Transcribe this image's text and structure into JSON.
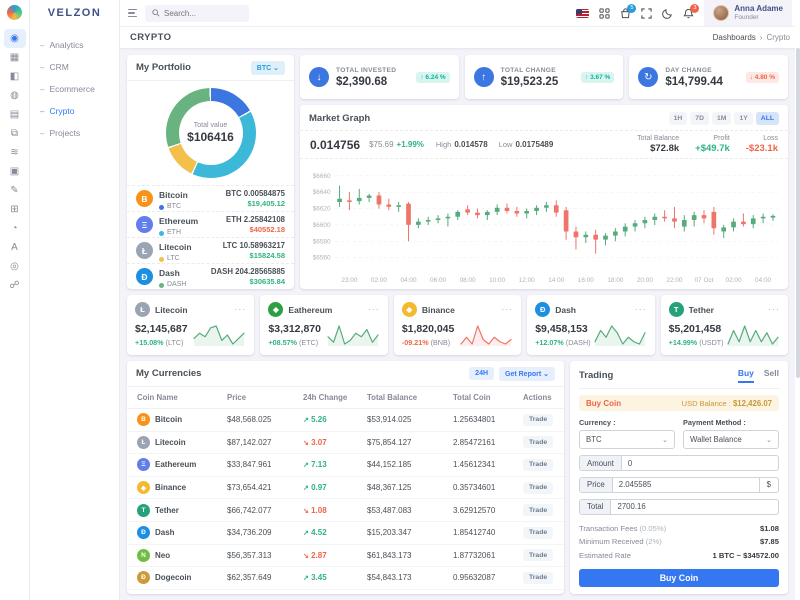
{
  "colors": {
    "accent": "#3577f1",
    "dark": "#405189",
    "success": "#2fb380",
    "danger": "#f06548",
    "warning": "#f7b84b",
    "muted": "#878a99",
    "candle_up": "#57ab7c",
    "candle_down": "#ee756a"
  },
  "brand": "VELZON",
  "navbar": {
    "search_placeholder": "Search...",
    "cart_badge": "5",
    "bell_badge": "3",
    "user": {
      "name": "Anna Adame",
      "role": "Founder"
    }
  },
  "rail": [
    {
      "name": "sidebar-item-dashboards",
      "glyph": "◉",
      "active": true
    },
    {
      "name": "sidebar-item-apps",
      "glyph": "▦"
    },
    {
      "name": "sidebar-item-layouts",
      "glyph": "◧"
    },
    {
      "name": "sidebar-item-auth",
      "glyph": "◍"
    },
    {
      "name": "sidebar-item-pages",
      "glyph": "▤"
    },
    {
      "name": "sidebar-item-widgets",
      "glyph": "⧉"
    },
    {
      "name": "sidebar-item-base-ui",
      "glyph": "≋"
    },
    {
      "name": "sidebar-item-advance-ui",
      "glyph": "▣"
    },
    {
      "name": "sidebar-item-forms",
      "glyph": "✎"
    },
    {
      "name": "sidebar-item-tables",
      "glyph": "⊞"
    },
    {
      "name": "sidebar-item-charts",
      "glyph": "◔"
    },
    {
      "name": "sidebar-item-icons",
      "glyph": "A"
    },
    {
      "name": "sidebar-item-maps",
      "glyph": "◎"
    },
    {
      "name": "sidebar-item-multilevel",
      "glyph": "☍"
    }
  ],
  "sidebar": {
    "items": [
      {
        "label": "Analytics"
      },
      {
        "label": "CRM"
      },
      {
        "label": "Ecommerce"
      },
      {
        "label": "Crypto",
        "active": true
      },
      {
        "label": "Projects"
      }
    ]
  },
  "page": {
    "title": "CRYPTO",
    "breadcrumb": [
      "Dashboards",
      "Crypto"
    ]
  },
  "portfolio": {
    "title": "My Portfolio",
    "currency_button": "BTC",
    "center_label": "Total value",
    "center_value": "$106416",
    "donut": [
      {
        "color": "#3b76e1",
        "deg": 62
      },
      {
        "color": "#3cb8d9",
        "deg": 144
      },
      {
        "color": "#f3c04b",
        "deg": 46
      },
      {
        "color": "#68b380",
        "deg": 108
      }
    ],
    "assets": [
      {
        "name": "Bitcoin",
        "code": "BTC",
        "glyph": "B",
        "icon_bg": "#f7931a",
        "bullet": "#3b76e1",
        "amount": "BTC 0.00584875",
        "value": "$19,405.12",
        "dir": "up"
      },
      {
        "name": "Ethereum",
        "code": "ETH",
        "glyph": "Ξ",
        "icon_bg": "#627eea",
        "bullet": "#3cb8d9",
        "amount": "ETH 2.25842108",
        "value": "$40552.18",
        "dir": "down"
      },
      {
        "name": "Litecoin",
        "code": "LTC",
        "glyph": "Ł",
        "icon_bg": "#9aa4b2",
        "bullet": "#f3c04b",
        "amount": "LTC 10.58963217",
        "value": "$15824.58",
        "dir": "up"
      },
      {
        "name": "Dash",
        "code": "DASH",
        "glyph": "Đ",
        "icon_bg": "#1c8fe0",
        "bullet": "#68b380",
        "amount": "DASH 204.28565885",
        "value": "$30635.84",
        "dir": "up"
      }
    ]
  },
  "stats": [
    {
      "name": "total-invested",
      "label": "TOTAL INVESTED",
      "value": "$2,390.68",
      "glyph": "↓",
      "badge": "6.24 %",
      "dir": "up"
    },
    {
      "name": "total-change",
      "label": "TOTAL CHANGE",
      "value": "$19,523.25",
      "glyph": "↑",
      "badge": "3.67 %",
      "dir": "up"
    },
    {
      "name": "day-change",
      "label": "DAY CHANGE",
      "value": "$14,799.44",
      "glyph": "↻",
      "badge": "4.80 %",
      "dir": "down"
    }
  ],
  "market": {
    "title": "Market Graph",
    "ranges": [
      "1H",
      "7D",
      "1M",
      "1Y",
      "ALL"
    ],
    "active_range": "ALL",
    "price": "0.014756",
    "price_usd": "$75.69",
    "price_pct": "+1.99%",
    "high_label": "High",
    "high": "0.014578",
    "low_label": "Low",
    "low": "0.0175489",
    "totals": [
      {
        "label": "Total Balance",
        "value": "$72.8k",
        "tone": "dark"
      },
      {
        "label": "Profit",
        "value": "+$49.7k",
        "tone": "up"
      },
      {
        "label": "Loss",
        "value": "-$23.1k",
        "tone": "down"
      }
    ]
  },
  "chart_data": {
    "type": "candlestick",
    "title": "Market Graph",
    "ylim": [
      6552,
      6668
    ],
    "y_ticks": [
      "$6560",
      "$6580",
      "$6600",
      "$6620",
      "$6640",
      "$6660"
    ],
    "x_labels": [
      "23:00",
      "02:00",
      "04:00",
      "06:00",
      "08:00",
      "10:00",
      "12:00",
      "14:00",
      "16:00",
      "18:00",
      "20:00",
      "22:00",
      "07 Oct",
      "02:00",
      "04:00"
    ],
    "candles": [
      [
        6628,
        6648,
        6622,
        6632
      ],
      [
        6630,
        6640,
        6618,
        6629
      ],
      [
        6629,
        6644,
        6625,
        6633
      ],
      [
        6633,
        6638,
        6628,
        6636
      ],
      [
        6636,
        6640,
        6620,
        6625
      ],
      [
        6625,
        6632,
        6618,
        6622
      ],
      [
        6622,
        6628,
        6616,
        6624
      ],
      [
        6626,
        6628,
        6580,
        6600
      ],
      [
        6600,
        6608,
        6596,
        6604
      ],
      [
        6604,
        6610,
        6600,
        6606
      ],
      [
        6606,
        6612,
        6602,
        6608
      ],
      [
        6608,
        6614,
        6598,
        6610
      ],
      [
        6610,
        6618,
        6606,
        6616
      ],
      [
        6619,
        6624,
        6612,
        6615
      ],
      [
        6615,
        6620,
        6608,
        6612
      ],
      [
        6612,
        6618,
        6606,
        6616
      ],
      [
        6616,
        6625,
        6612,
        6621
      ],
      [
        6621,
        6626,
        6614,
        6617
      ],
      [
        6617,
        6622,
        6610,
        6614
      ],
      [
        6614,
        6620,
        6608,
        6617
      ],
      [
        6617,
        6624,
        6612,
        6621
      ],
      [
        6621,
        6628,
        6616,
        6624
      ],
      [
        6624,
        6630,
        6610,
        6615
      ],
      [
        6618,
        6622,
        6582,
        6592
      ],
      [
        6592,
        6598,
        6570,
        6585
      ],
      [
        6585,
        6592,
        6578,
        6588
      ],
      [
        6588,
        6594,
        6565,
        6582
      ],
      [
        6582,
        6590,
        6575,
        6587
      ],
      [
        6587,
        6596,
        6580,
        6592
      ],
      [
        6592,
        6602,
        6586,
        6598
      ],
      [
        6598,
        6606,
        6592,
        6602
      ],
      [
        6602,
        6610,
        6596,
        6606
      ],
      [
        6606,
        6614,
        6600,
        6610
      ],
      [
        6610,
        6618,
        6604,
        6608
      ],
      [
        6608,
        6622,
        6596,
        6604
      ],
      [
        6598,
        6612,
        6592,
        6606
      ],
      [
        6606,
        6616,
        6598,
        6612
      ],
      [
        6612,
        6618,
        6602,
        6608
      ],
      [
        6616,
        6622,
        6588,
        6596
      ],
      [
        6592,
        6600,
        6584,
        6597
      ],
      [
        6597,
        6608,
        6592,
        6604
      ],
      [
        6604,
        6614,
        6598,
        6601
      ],
      [
        6601,
        6612,
        6596,
        6608
      ],
      [
        6608,
        6614,
        6602,
        6610
      ],
      [
        6610,
        6613,
        6605,
        6611
      ]
    ]
  },
  "coin_cards": [
    {
      "name": "Litecoin",
      "glyph": "Ł",
      "icon_bg": "#9aa4b2",
      "value": "$2,145,687",
      "change": "+15.08%",
      "code": "(LTC)",
      "dir": "up",
      "spark": [
        8,
        11,
        9,
        14,
        15,
        7,
        10,
        5,
        8,
        11
      ]
    },
    {
      "name": "Eathereum",
      "glyph": "◆",
      "icon_bg": "#2f9e44",
      "value": "$3,312,870",
      "change": "+08.57%",
      "code": "(ETC)",
      "dir": "up",
      "spark": [
        9,
        6,
        15,
        5,
        7,
        11,
        9,
        13,
        6,
        10
      ]
    },
    {
      "name": "Binance",
      "glyph": "◆",
      "icon_bg": "#f3ba2f",
      "value": "$1,820,045",
      "change": "-09.21%",
      "code": "(BNB)",
      "dir": "down",
      "spark": [
        6,
        9,
        6,
        14,
        8,
        6,
        9,
        7,
        6,
        8
      ]
    },
    {
      "name": "Dash",
      "glyph": "Đ",
      "icon_bg": "#1c8fe0",
      "value": "$9,458,153",
      "change": "+12.07%",
      "code": "(DASH)",
      "dir": "up",
      "spark": [
        7,
        12,
        9,
        14,
        11,
        6,
        9,
        7,
        6,
        11
      ]
    },
    {
      "name": "Tether",
      "glyph": "T",
      "icon_bg": "#26a17b",
      "value": "$5,201,458",
      "change": "+14.99%",
      "code": "(USDT)",
      "dir": "up",
      "spark": [
        6,
        12,
        7,
        14,
        7,
        12,
        7,
        11,
        6,
        9
      ]
    }
  ],
  "currencies": {
    "title": "My Currencies",
    "range_button": "24H",
    "report_button": "Get Report",
    "columns": [
      "Coin Name",
      "Price",
      "24h Change",
      "Total Balance",
      "Total Coin",
      "Actions"
    ],
    "rows": [
      {
        "name": "Bitcoin",
        "glyph": "B",
        "icon_bg": "#f7931a",
        "price": "$48,568.025",
        "change": "5.26",
        "dir": "up",
        "balance": "$53,914.025",
        "coin": "1.25634801",
        "action": "Trade"
      },
      {
        "name": "Litecoin",
        "glyph": "Ł",
        "icon_bg": "#9aa4b2",
        "price": "$87,142.027",
        "change": "3.07",
        "dir": "down",
        "balance": "$75,854.127",
        "coin": "2.85472161",
        "action": "Trade"
      },
      {
        "name": "Eathereum",
        "glyph": "Ξ",
        "icon_bg": "#627eea",
        "price": "$33,847.961",
        "change": "7.13",
        "dir": "up",
        "balance": "$44,152.185",
        "coin": "1.45612341",
        "action": "Trade"
      },
      {
        "name": "Binance",
        "glyph": "◆",
        "icon_bg": "#f3ba2f",
        "price": "$73,654.421",
        "change": "0.97",
        "dir": "up",
        "balance": "$48,367.125",
        "coin": "0.35734601",
        "action": "Trade"
      },
      {
        "name": "Tether",
        "glyph": "T",
        "icon_bg": "#26a17b",
        "price": "$66,742.077",
        "change": "1.08",
        "dir": "down",
        "balance": "$53,487.083",
        "coin": "3.62912570",
        "action": "Trade"
      },
      {
        "name": "Dash",
        "glyph": "Đ",
        "icon_bg": "#1c8fe0",
        "price": "$34,736.209",
        "change": "4.52",
        "dir": "up",
        "balance": "$15,203.347",
        "coin": "1.85412740",
        "action": "Trade"
      },
      {
        "name": "Neo",
        "glyph": "N",
        "icon_bg": "#6fbe44",
        "price": "$56,357.313",
        "change": "2.87",
        "dir": "down",
        "balance": "$61,843.173",
        "coin": "1.87732061",
        "action": "Trade"
      },
      {
        "name": "Dogecoin",
        "glyph": "Ð",
        "icon_bg": "#cb9b3a",
        "price": "$62,357.649",
        "change": "3.45",
        "dir": "up",
        "balance": "$54,843.173",
        "coin": "0.95632087",
        "action": "Trade"
      }
    ]
  },
  "trading": {
    "title": "Trading",
    "tabs": [
      "Buy",
      "Sell"
    ],
    "active_tab": "Buy",
    "alert_left": "Buy Coin",
    "alert_right_label": "USD Balance :",
    "alert_right_value": "$12,426.07",
    "currency_label": "Currency :",
    "currency_value": "BTC",
    "payment_label": "Payment Method :",
    "payment_value": "Wallet Balance",
    "amount_label": "Amount",
    "amount_value": "0",
    "price_label": "Price",
    "price_value": "2.045585",
    "price_suffix": "$",
    "total_label": "Total",
    "total_value": "2700.16",
    "summary": [
      {
        "label": "Transaction Fees",
        "note": "(0.05%)",
        "value": "$1.08"
      },
      {
        "label": "Minimum Received",
        "note": "(2%)",
        "value": "$7.85"
      },
      {
        "label": "Estimated Rate",
        "note": "",
        "value": "1 BTC ~ $34572.00"
      }
    ],
    "submit": "Buy Coin"
  }
}
